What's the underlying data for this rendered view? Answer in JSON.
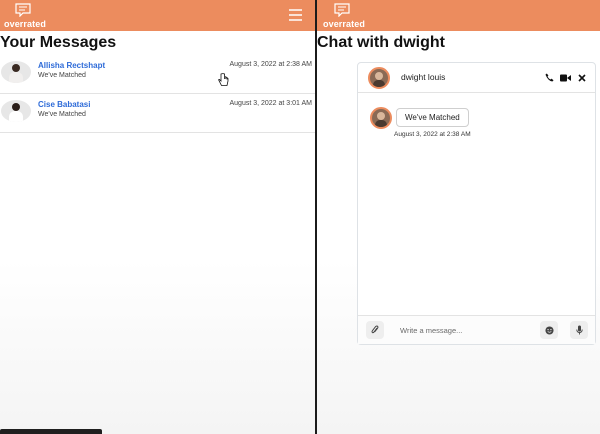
{
  "brand": {
    "name": "overrated",
    "icon": "chat-bubble-icon"
  },
  "left": {
    "heading": "Your Messages",
    "messages": [
      {
        "name": "Allisha Rectshapt",
        "preview": "We've Matched",
        "time": "August 3, 2022 at 2:38 AM"
      },
      {
        "name": "Cise Babatasi",
        "preview": "We've Matched",
        "time": "August 3, 2022 at 3:01 AM"
      }
    ]
  },
  "right": {
    "heading": "Chat with dwight",
    "chat": {
      "user": "dwight louis",
      "header_icons": [
        "phone-icon",
        "video-icon",
        "close-icon"
      ],
      "messages": [
        {
          "text": "We've Matched",
          "time": "August 3, 2022 at 2:38 AM"
        }
      ],
      "input_placeholder": "Write a message...",
      "footer_icons": [
        "paperclip-icon",
        "emoji-icon",
        "microphone-icon"
      ]
    }
  },
  "colors": {
    "navbar": "#ec8c5e",
    "link": "#2e6bd8"
  }
}
